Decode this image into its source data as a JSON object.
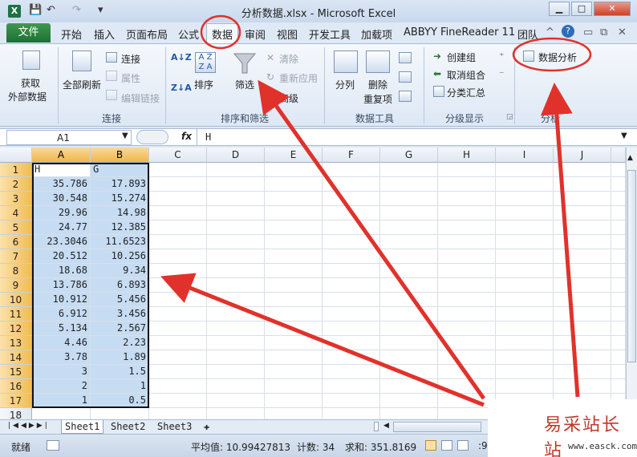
{
  "window": {
    "title": "分析数据.xlsx - Microsoft Excel",
    "logo": "X",
    "min": "▁",
    "max": "□",
    "close": "✕"
  },
  "quick_access": {
    "save_icon": "save-icon",
    "undo_icon": "undo-icon",
    "redo_icon": "redo-icon"
  },
  "tabs": [
    {
      "label": "文件"
    },
    {
      "label": "开始"
    },
    {
      "label": "插入"
    },
    {
      "label": "页面布局"
    },
    {
      "label": "公式"
    },
    {
      "label": "数据"
    },
    {
      "label": "审阅"
    },
    {
      "label": "视图"
    },
    {
      "label": "开发工具"
    },
    {
      "label": "加载项"
    },
    {
      "label": "ABBYY FineReader 11"
    },
    {
      "label": "团队"
    }
  ],
  "ribbon": {
    "get_external": "获取\n外部数据",
    "get_external_1": "获取",
    "get_external_2": "外部数据",
    "refresh_all": "全部刷新",
    "connections": "连接",
    "properties": "属性",
    "edit_links": "编辑链接",
    "sort": "排序",
    "filter": "筛选",
    "clear": "清除",
    "reapply": "重新应用",
    "advanced": "高级",
    "split": "分列",
    "remove_dup_1": "删除",
    "remove_dup_2": "重复项",
    "group": "创建组",
    "ungroup": "取消组合",
    "subtotal": "分类汇总",
    "data_analysis": "数据分析",
    "groups": {
      "connections": "连接",
      "sort_filter": "排序和筛选",
      "data_tools": "数据工具",
      "outline": "分级显示",
      "analysis": "分析"
    }
  },
  "formula": {
    "name_box": "A1",
    "fx": "fx",
    "value": "H"
  },
  "columns": [
    "A",
    "B",
    "C",
    "D",
    "E",
    "F",
    "G",
    "H",
    "I",
    "J"
  ],
  "rows": [
    {
      "n": "1",
      "a": "H",
      "b": "G"
    },
    {
      "n": "2",
      "a": "35.786",
      "b": "17.893"
    },
    {
      "n": "3",
      "a": "30.548",
      "b": "15.274"
    },
    {
      "n": "4",
      "a": "29.96",
      "b": "14.98"
    },
    {
      "n": "5",
      "a": "24.77",
      "b": "12.385"
    },
    {
      "n": "6",
      "a": "23.3046",
      "b": "11.6523"
    },
    {
      "n": "7",
      "a": "20.512",
      "b": "10.256"
    },
    {
      "n": "8",
      "a": "18.68",
      "b": "9.34"
    },
    {
      "n": "9",
      "a": "13.786",
      "b": "6.893"
    },
    {
      "n": "10",
      "a": "10.912",
      "b": "5.456"
    },
    {
      "n": "11",
      "a": "6.912",
      "b": "3.456"
    },
    {
      "n": "12",
      "a": "5.134",
      "b": "2.567"
    },
    {
      "n": "13",
      "a": "4.46",
      "b": "2.23"
    },
    {
      "n": "14",
      "a": "3.78",
      "b": "1.89"
    },
    {
      "n": "15",
      "a": "3",
      "b": "1.5"
    },
    {
      "n": "16",
      "a": "2",
      "b": "1"
    },
    {
      "n": "17",
      "a": "1",
      "b": "0.5"
    },
    {
      "n": "18",
      "a": "",
      "b": ""
    }
  ],
  "sheets": [
    "Sheet1",
    "Sheet2",
    "Sheet3"
  ],
  "status": {
    "ready": "就绪",
    "average": "平均值: 10.99427813",
    "count": "计数: 34",
    "sum": "求和: 351.8169",
    "extra": ":99427813"
  },
  "watermark": {
    "main": "易采站长站",
    "sub": "www.easck.com"
  },
  "colors": {
    "excel_green": "#1e7145",
    "selection": "#c6dcf3",
    "annotation_red": "#e0322b"
  }
}
